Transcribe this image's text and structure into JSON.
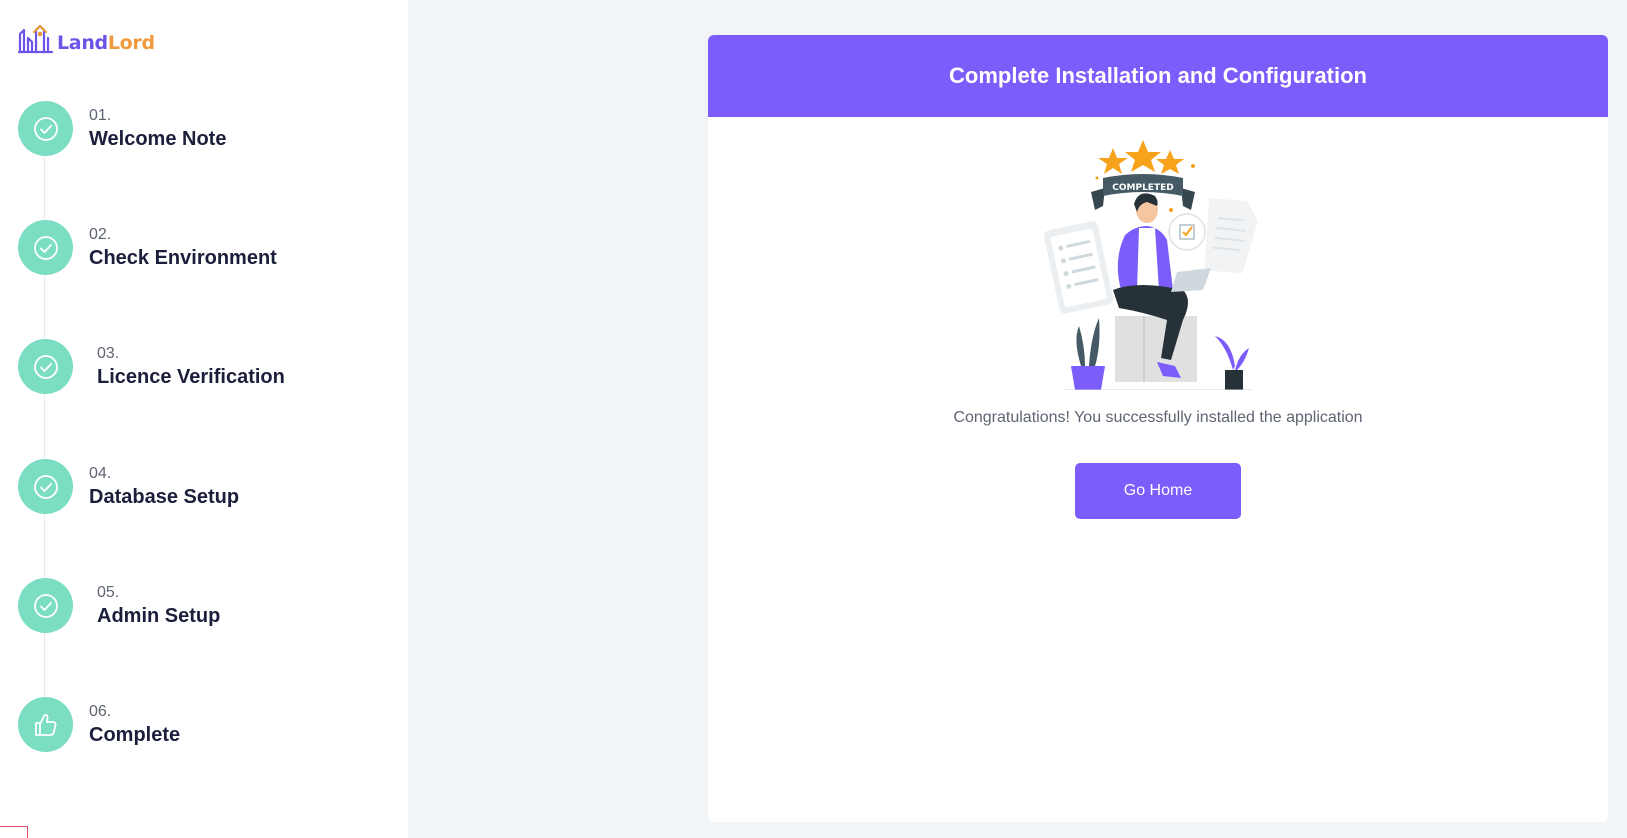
{
  "brand": {
    "part1": "Land",
    "part2": "Lord",
    "accent_purple": "#6a55e8",
    "accent_orange": "#f09a3e"
  },
  "steps": [
    {
      "number": "01.",
      "title": "Welcome Note",
      "icon": "check-icon",
      "status": "done"
    },
    {
      "number": "02.",
      "title": "Check Environment",
      "icon": "check-icon",
      "status": "done"
    },
    {
      "number": "03.",
      "title": "Licence Verification",
      "icon": "check-icon",
      "status": "done"
    },
    {
      "number": "04.",
      "title": "Database Setup",
      "icon": "check-icon",
      "status": "done"
    },
    {
      "number": "05.",
      "title": "Admin Setup",
      "icon": "check-icon",
      "status": "done"
    },
    {
      "number": "06.",
      "title": "Complete",
      "icon": "thumbs-up-icon",
      "status": "current"
    }
  ],
  "main": {
    "title": "Complete Installation and Configuration",
    "illustration_badge": "COMPLETED",
    "message": "Congratulations! You successfully installed the application",
    "button_label": "Go Home"
  },
  "colors": {
    "header": "#7c5cfa",
    "step_circle": "#7bddc2",
    "background": "#f2f5f8"
  }
}
